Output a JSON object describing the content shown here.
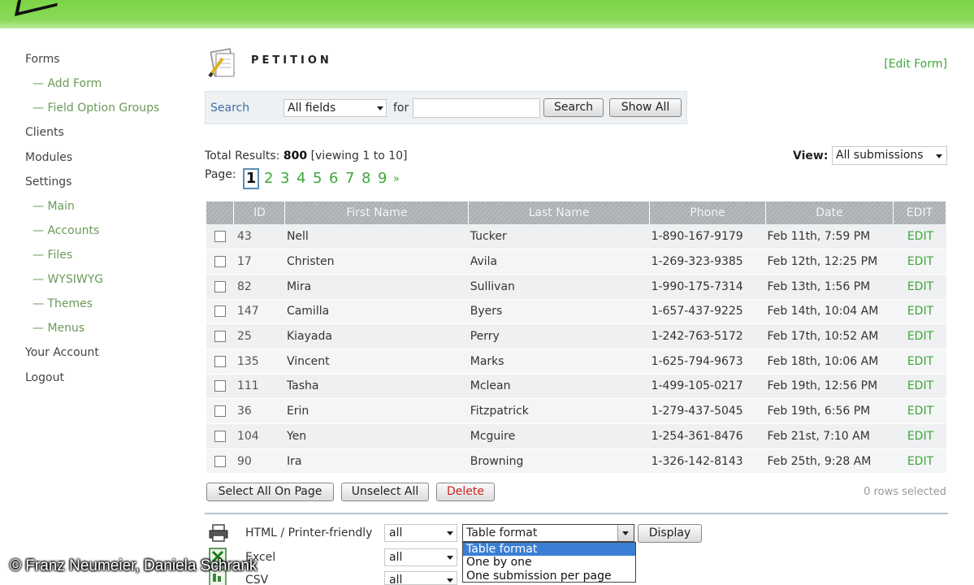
{
  "sidebar": {
    "items": [
      {
        "label": "Forms",
        "level": 0
      },
      {
        "label": "Add Form",
        "level": 1
      },
      {
        "label": "Field Option Groups",
        "level": 1
      },
      {
        "label": "Clients",
        "level": 0
      },
      {
        "label": "Modules",
        "level": 0
      },
      {
        "label": "Settings",
        "level": 0
      },
      {
        "label": "Main",
        "level": 1
      },
      {
        "label": "Accounts",
        "level": 1
      },
      {
        "label": "Files",
        "level": 1
      },
      {
        "label": "WYSIWYG",
        "level": 1
      },
      {
        "label": "Themes",
        "level": 1
      },
      {
        "label": "Menus",
        "level": 1
      },
      {
        "label": "Your Account",
        "level": 0
      },
      {
        "label": "Logout",
        "level": 0
      }
    ]
  },
  "header": {
    "title": "PETITION",
    "edit_form_link": "[Edit Form]"
  },
  "search": {
    "label": "Search",
    "field_select": "All fields",
    "for_label": "for",
    "input_value": "",
    "search_button": "Search",
    "show_all_button": "Show All"
  },
  "results": {
    "total_label": "Total Results:",
    "total_count": "800",
    "viewing": "[viewing 1 to 10]",
    "page_label": "Page:",
    "current_page": "1",
    "pages": [
      "2",
      "3",
      "4",
      "5",
      "6",
      "7",
      "8",
      "9",
      "»"
    ],
    "view_label": "View:",
    "view_select": "All submissions"
  },
  "table": {
    "columns": [
      "ID",
      "First Name",
      "Last Name",
      "Phone",
      "Date",
      "EDIT"
    ],
    "rows": [
      {
        "id": "43",
        "first": "Nell",
        "last": "Tucker",
        "phone": "1-890-167-9179",
        "date": "Feb 11th, 7:59 PM",
        "edit": "EDIT"
      },
      {
        "id": "17",
        "first": "Christen",
        "last": "Avila",
        "phone": "1-269-323-9385",
        "date": "Feb 12th, 12:25 PM",
        "edit": "EDIT"
      },
      {
        "id": "82",
        "first": "Mira",
        "last": "Sullivan",
        "phone": "1-990-175-7314",
        "date": "Feb 13th, 1:56 PM",
        "edit": "EDIT"
      },
      {
        "id": "147",
        "first": "Camilla",
        "last": "Byers",
        "phone": "1-657-437-9225",
        "date": "Feb 14th, 10:04 AM",
        "edit": "EDIT"
      },
      {
        "id": "25",
        "first": "Kiayada",
        "last": "Perry",
        "phone": "1-242-763-5172",
        "date": "Feb 17th, 10:52 AM",
        "edit": "EDIT"
      },
      {
        "id": "135",
        "first": "Vincent",
        "last": "Marks",
        "phone": "1-625-794-9673",
        "date": "Feb 18th, 10:06 AM",
        "edit": "EDIT"
      },
      {
        "id": "111",
        "first": "Tasha",
        "last": "Mclean",
        "phone": "1-499-105-0217",
        "date": "Feb 19th, 12:56 PM",
        "edit": "EDIT"
      },
      {
        "id": "36",
        "first": "Erin",
        "last": "Fitzpatrick",
        "phone": "1-279-437-5045",
        "date": "Feb 19th, 6:56 PM",
        "edit": "EDIT"
      },
      {
        "id": "104",
        "first": "Yen",
        "last": "Mcguire",
        "phone": "1-254-361-8476",
        "date": "Feb 21st, 7:10 AM",
        "edit": "EDIT"
      },
      {
        "id": "90",
        "first": "Ira",
        "last": "Browning",
        "phone": "1-326-142-8143",
        "date": "Feb 25th, 9:28 AM",
        "edit": "EDIT"
      }
    ]
  },
  "actions": {
    "select_all": "Select All On Page",
    "unselect_all": "Unselect All",
    "delete": "Delete",
    "rows_selected": "0 rows selected"
  },
  "export": {
    "html_label": "HTML / Printer-friendly",
    "html_select": "all",
    "format_select": "Table format",
    "display_button": "Display",
    "excel_label": "Excel",
    "excel_select": "all",
    "csv_label": "CSV",
    "csv_select": "all",
    "format_options": [
      "Table format",
      "One by one",
      "One submission per page"
    ]
  },
  "watermark": "© Franz Neumeier, Daniela Schrank",
  "colors": {
    "topbar": "#8ad957",
    "link_green": "#3fa63a",
    "selected_option": "#3a7fd5",
    "delete_red": "#cc2222"
  },
  "icons": {
    "form": "pencil-paper-icon",
    "printer": "printer-icon",
    "excel": "excel-icon",
    "csv": "csv-icon"
  }
}
